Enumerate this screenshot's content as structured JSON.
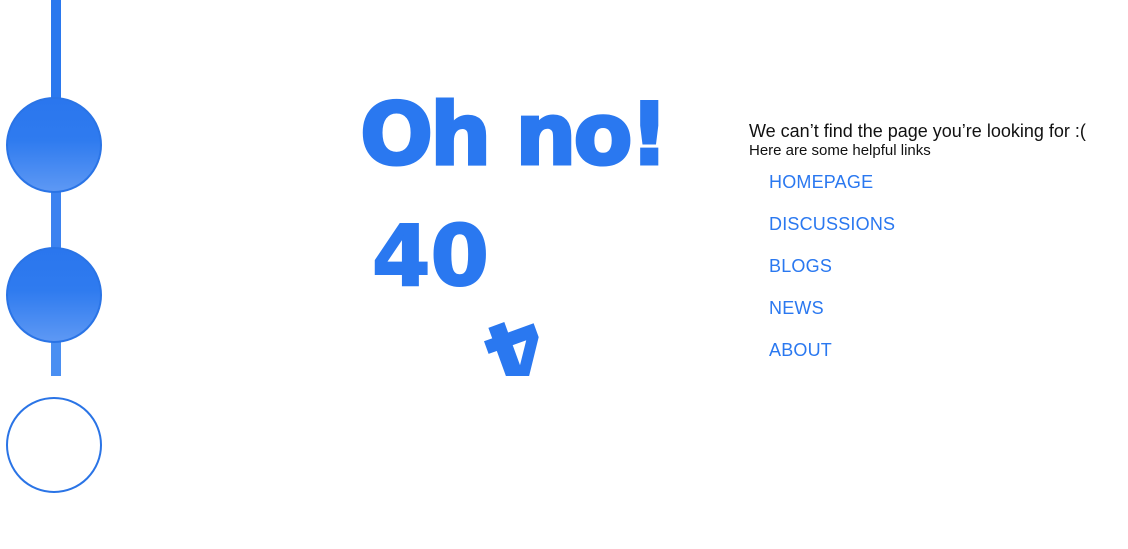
{
  "headline": "Oh no!",
  "error_code": {
    "standing": "40",
    "fallen": "4"
  },
  "message": "We can’t find the page you’re looking for :(",
  "subtitle": "Here are some helpful links",
  "links": [
    {
      "label": "HOMEPAGE"
    },
    {
      "label": "DISCUSSIONS"
    },
    {
      "label": "BLOGS"
    },
    {
      "label": "NEWS"
    },
    {
      "label": "ABOUT"
    }
  ],
  "colors": {
    "accent": "#2a78f0",
    "text": "#111111",
    "background": "#ffffff"
  },
  "progress": {
    "total_steps": 3,
    "filled_steps": 2
  }
}
